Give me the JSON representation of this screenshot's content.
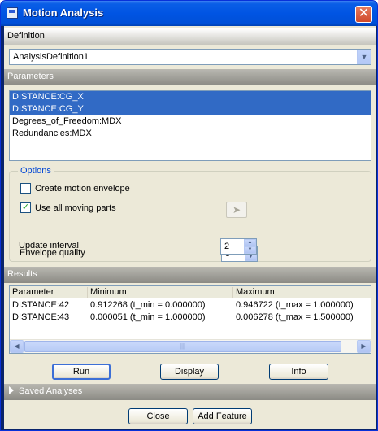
{
  "window": {
    "title": "Motion Analysis",
    "close_glyph": "✕"
  },
  "definition": {
    "header": "Definition",
    "selected": "AnalysisDefinition1"
  },
  "parameters": {
    "header": "Parameters",
    "items": [
      {
        "label": "DISTANCE:CG_X",
        "selected": true
      },
      {
        "label": "DISTANCE:CG_Y",
        "selected": true
      },
      {
        "label": "Degrees_of_Freedom:MDX",
        "selected": false
      },
      {
        "label": "Redundancies:MDX",
        "selected": false
      }
    ]
  },
  "options": {
    "legend": "Options",
    "create_envelope_label": "Create motion envelope",
    "create_envelope_checked": false,
    "use_moving_parts_label": "Use all moving parts",
    "use_moving_parts_checked": true,
    "envelope_quality_label": "Envelope quality",
    "envelope_quality_value": "5",
    "update_interval_label": "Update interval",
    "update_interval_value": "2"
  },
  "results": {
    "header": "Results",
    "columns": [
      "Parameter",
      "Minimum",
      "Maximum"
    ],
    "rows": [
      [
        "DISTANCE:42",
        "0.912268 (t_min = 0.000000)",
        "0.946722 (t_max = 1.000000)"
      ],
      [
        "DISTANCE:43",
        "0.000051 (t_min = 1.000000)",
        "0.006278 (t_max = 1.500000)"
      ]
    ]
  },
  "buttons": {
    "run": "Run",
    "display": "Display",
    "info": "Info",
    "close": "Close",
    "add_feature": "Add Feature"
  },
  "saved_analyses": {
    "label": "Saved Analyses"
  }
}
